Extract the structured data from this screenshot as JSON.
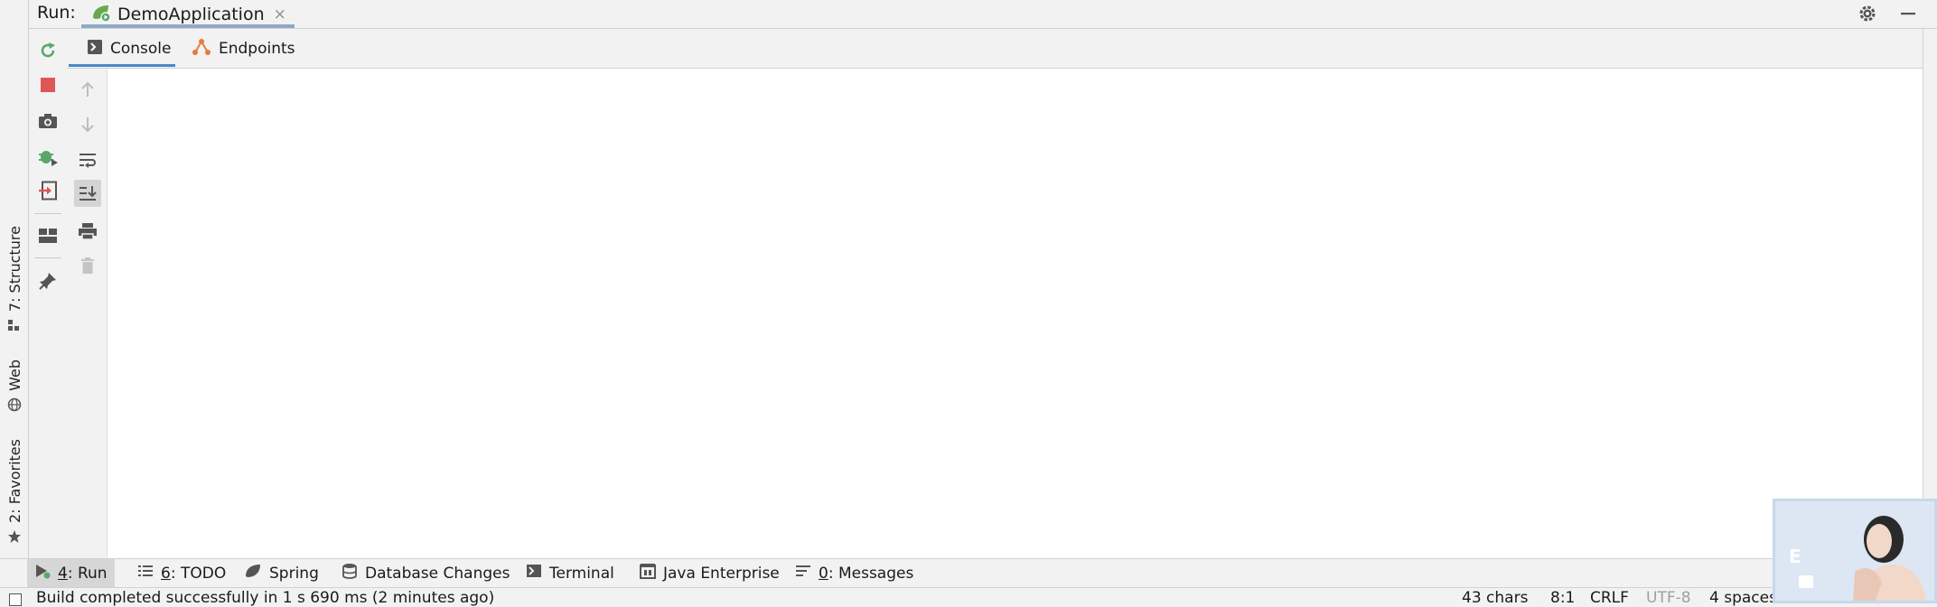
{
  "header": {
    "run_label": "Run:",
    "tab_name": "DemoApplication",
    "tab_close": "×"
  },
  "subtabs": [
    {
      "label": "Console"
    },
    {
      "label": "Endpoints"
    }
  ],
  "left_strip": [
    {
      "label": "7: Structure",
      "icon": "structure-icon"
    },
    {
      "label": "Web",
      "icon": "globe-icon"
    },
    {
      "label": "2: Favorites",
      "icon": "star-icon"
    }
  ],
  "bottom_tabs": [
    {
      "num": "4",
      "label": ": Run",
      "icon": "run-play-icon"
    },
    {
      "num": "6",
      "label": ": TODO",
      "icon": "todo-list-icon"
    },
    {
      "num": "",
      "label": "Spring",
      "icon": "spring-leaf-icon"
    },
    {
      "num": "",
      "label": "Database Changes",
      "icon": "database-icon"
    },
    {
      "num": "",
      "label": "Terminal",
      "icon": "terminal-icon"
    },
    {
      "num": "",
      "label": "Java Enterprise",
      "icon": "java-enterprise-icon"
    },
    {
      "num": "0",
      "label": ": Messages",
      "icon": "messages-icon"
    }
  ],
  "status": {
    "message": "Build completed successfully in 1 s 690 ms (2 minutes ago)",
    "chars": "43 chars",
    "position": "8:1",
    "line_sep": "CRLF",
    "encoding": "UTF-8",
    "indent": "4 spaces"
  },
  "overlay": {
    "letter": "E"
  },
  "colors": {
    "accent_blue": "#4a88c7",
    "run_green": "#59a869",
    "stop_red": "#e05555",
    "endpoints_orange": "#e8793d"
  }
}
